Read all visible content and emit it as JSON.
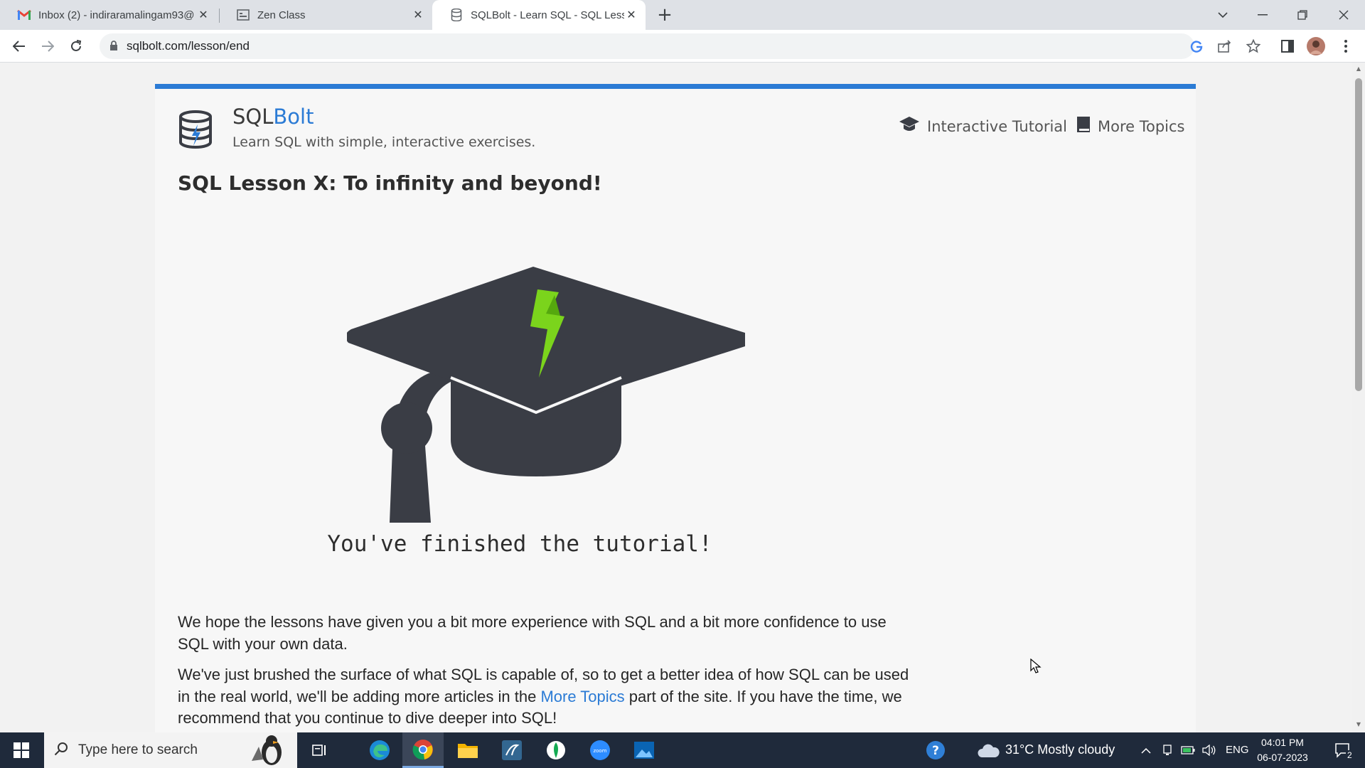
{
  "browser": {
    "tabs": [
      {
        "title": "Inbox (2) - indiraramalingam93@",
        "icon": "gmail-icon"
      },
      {
        "title": "Zen Class",
        "icon": "page-icon"
      },
      {
        "title": "SQLBolt - Learn SQL - SQL Lesso",
        "icon": "database-icon"
      }
    ],
    "url": "sqlbolt.com/lesson/end"
  },
  "site": {
    "brand_prefix": "SQL",
    "brand_suffix": "Bolt",
    "tagline": "Learn SQL with simple, interactive exercises.",
    "nav": [
      {
        "label": "Interactive Tutorial",
        "icon": "graduation-cap-icon"
      },
      {
        "label": "More Topics",
        "icon": "book-icon"
      }
    ]
  },
  "page": {
    "title": "SQL Lesson X: To infinity and beyond!",
    "finished_text": "You've finished the tutorial!",
    "para1": "We hope the lessons have given you a bit more experience with SQL and a bit more confidence to use SQL with your own data.",
    "para2_before": "We've just brushed the surface of what SQL is capable of, so to get a better idea of how SQL can be used in the real world, we'll be adding more articles in the ",
    "para2_link": "More Topics",
    "para2_after": " part of the site. If you have the time, we recommend that you continue to dive deeper into SQL!"
  },
  "taskbar": {
    "search_placeholder": "Type here to search",
    "weather": "31°C  Mostly cloudy",
    "language": "ENG",
    "time": "04:01 PM",
    "date": "06-07-2023",
    "notifications": "2"
  },
  "colors": {
    "accent": "#2b7bd5",
    "cap": "#3a3d45",
    "bolt": "#7bd41c"
  }
}
